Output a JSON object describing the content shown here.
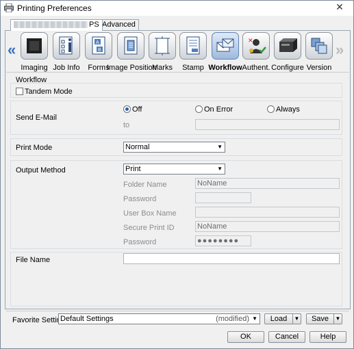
{
  "window": {
    "title": "Printing Preferences",
    "close_glyph": "✕"
  },
  "tabs": [
    {
      "label": "PS"
    },
    {
      "label": "Advanced"
    }
  ],
  "strip": {
    "items": [
      {
        "label": "Imaging",
        "icon": "imaging-icon"
      },
      {
        "label": "Job Info",
        "icon": "job-info-icon"
      },
      {
        "label": "Forms",
        "icon": "forms-icon"
      },
      {
        "label": "Image Position",
        "icon": "image-position-icon"
      },
      {
        "label": "Marks",
        "icon": "marks-icon"
      },
      {
        "label": "Stamp",
        "icon": "stamp-icon"
      },
      {
        "label": "Workflow",
        "icon": "workflow-icon",
        "selected": true
      },
      {
        "label": "Authent.",
        "icon": "authentication-icon"
      },
      {
        "label": "Configure",
        "icon": "configure-icon"
      },
      {
        "label": "Version",
        "icon": "version-icon"
      }
    ],
    "left_arrow": "«",
    "right_arrow": "»"
  },
  "workflow": {
    "section_title": "Workflow",
    "tandem_mode_label": "Tandem Mode",
    "send_email": {
      "label": "Send E-Mail",
      "options": [
        "Off",
        "On Error",
        "Always"
      ],
      "selected": "Off",
      "to_label": "to",
      "to_value": ""
    },
    "print_mode": {
      "label": "Print Mode",
      "value": "Normal"
    },
    "output_method": {
      "label": "Output Method",
      "value": "Print",
      "folder_name_label": "Folder Name",
      "folder_name_value": "NoName",
      "password_label": "Password",
      "password_value": "",
      "user_box_name_label": "User Box Name",
      "user_box_name_value": "",
      "secure_print_id_label": "Secure Print ID",
      "secure_print_id_value": "NoName",
      "password2_label": "Password",
      "password2_value": "●●●●●●●●"
    },
    "file_name": {
      "label": "File Name",
      "value": ""
    }
  },
  "favorite": {
    "label": "Favorite Setting",
    "value": "Default Settings",
    "modified": "(modified)",
    "load_label": "Load",
    "save_label": "Save"
  },
  "buttons": {
    "ok": "OK",
    "cancel": "Cancel",
    "help": "Help"
  },
  "colors": {
    "selected_icon": "#9fb9dc",
    "accent_arrow": "#3a6fc2"
  }
}
